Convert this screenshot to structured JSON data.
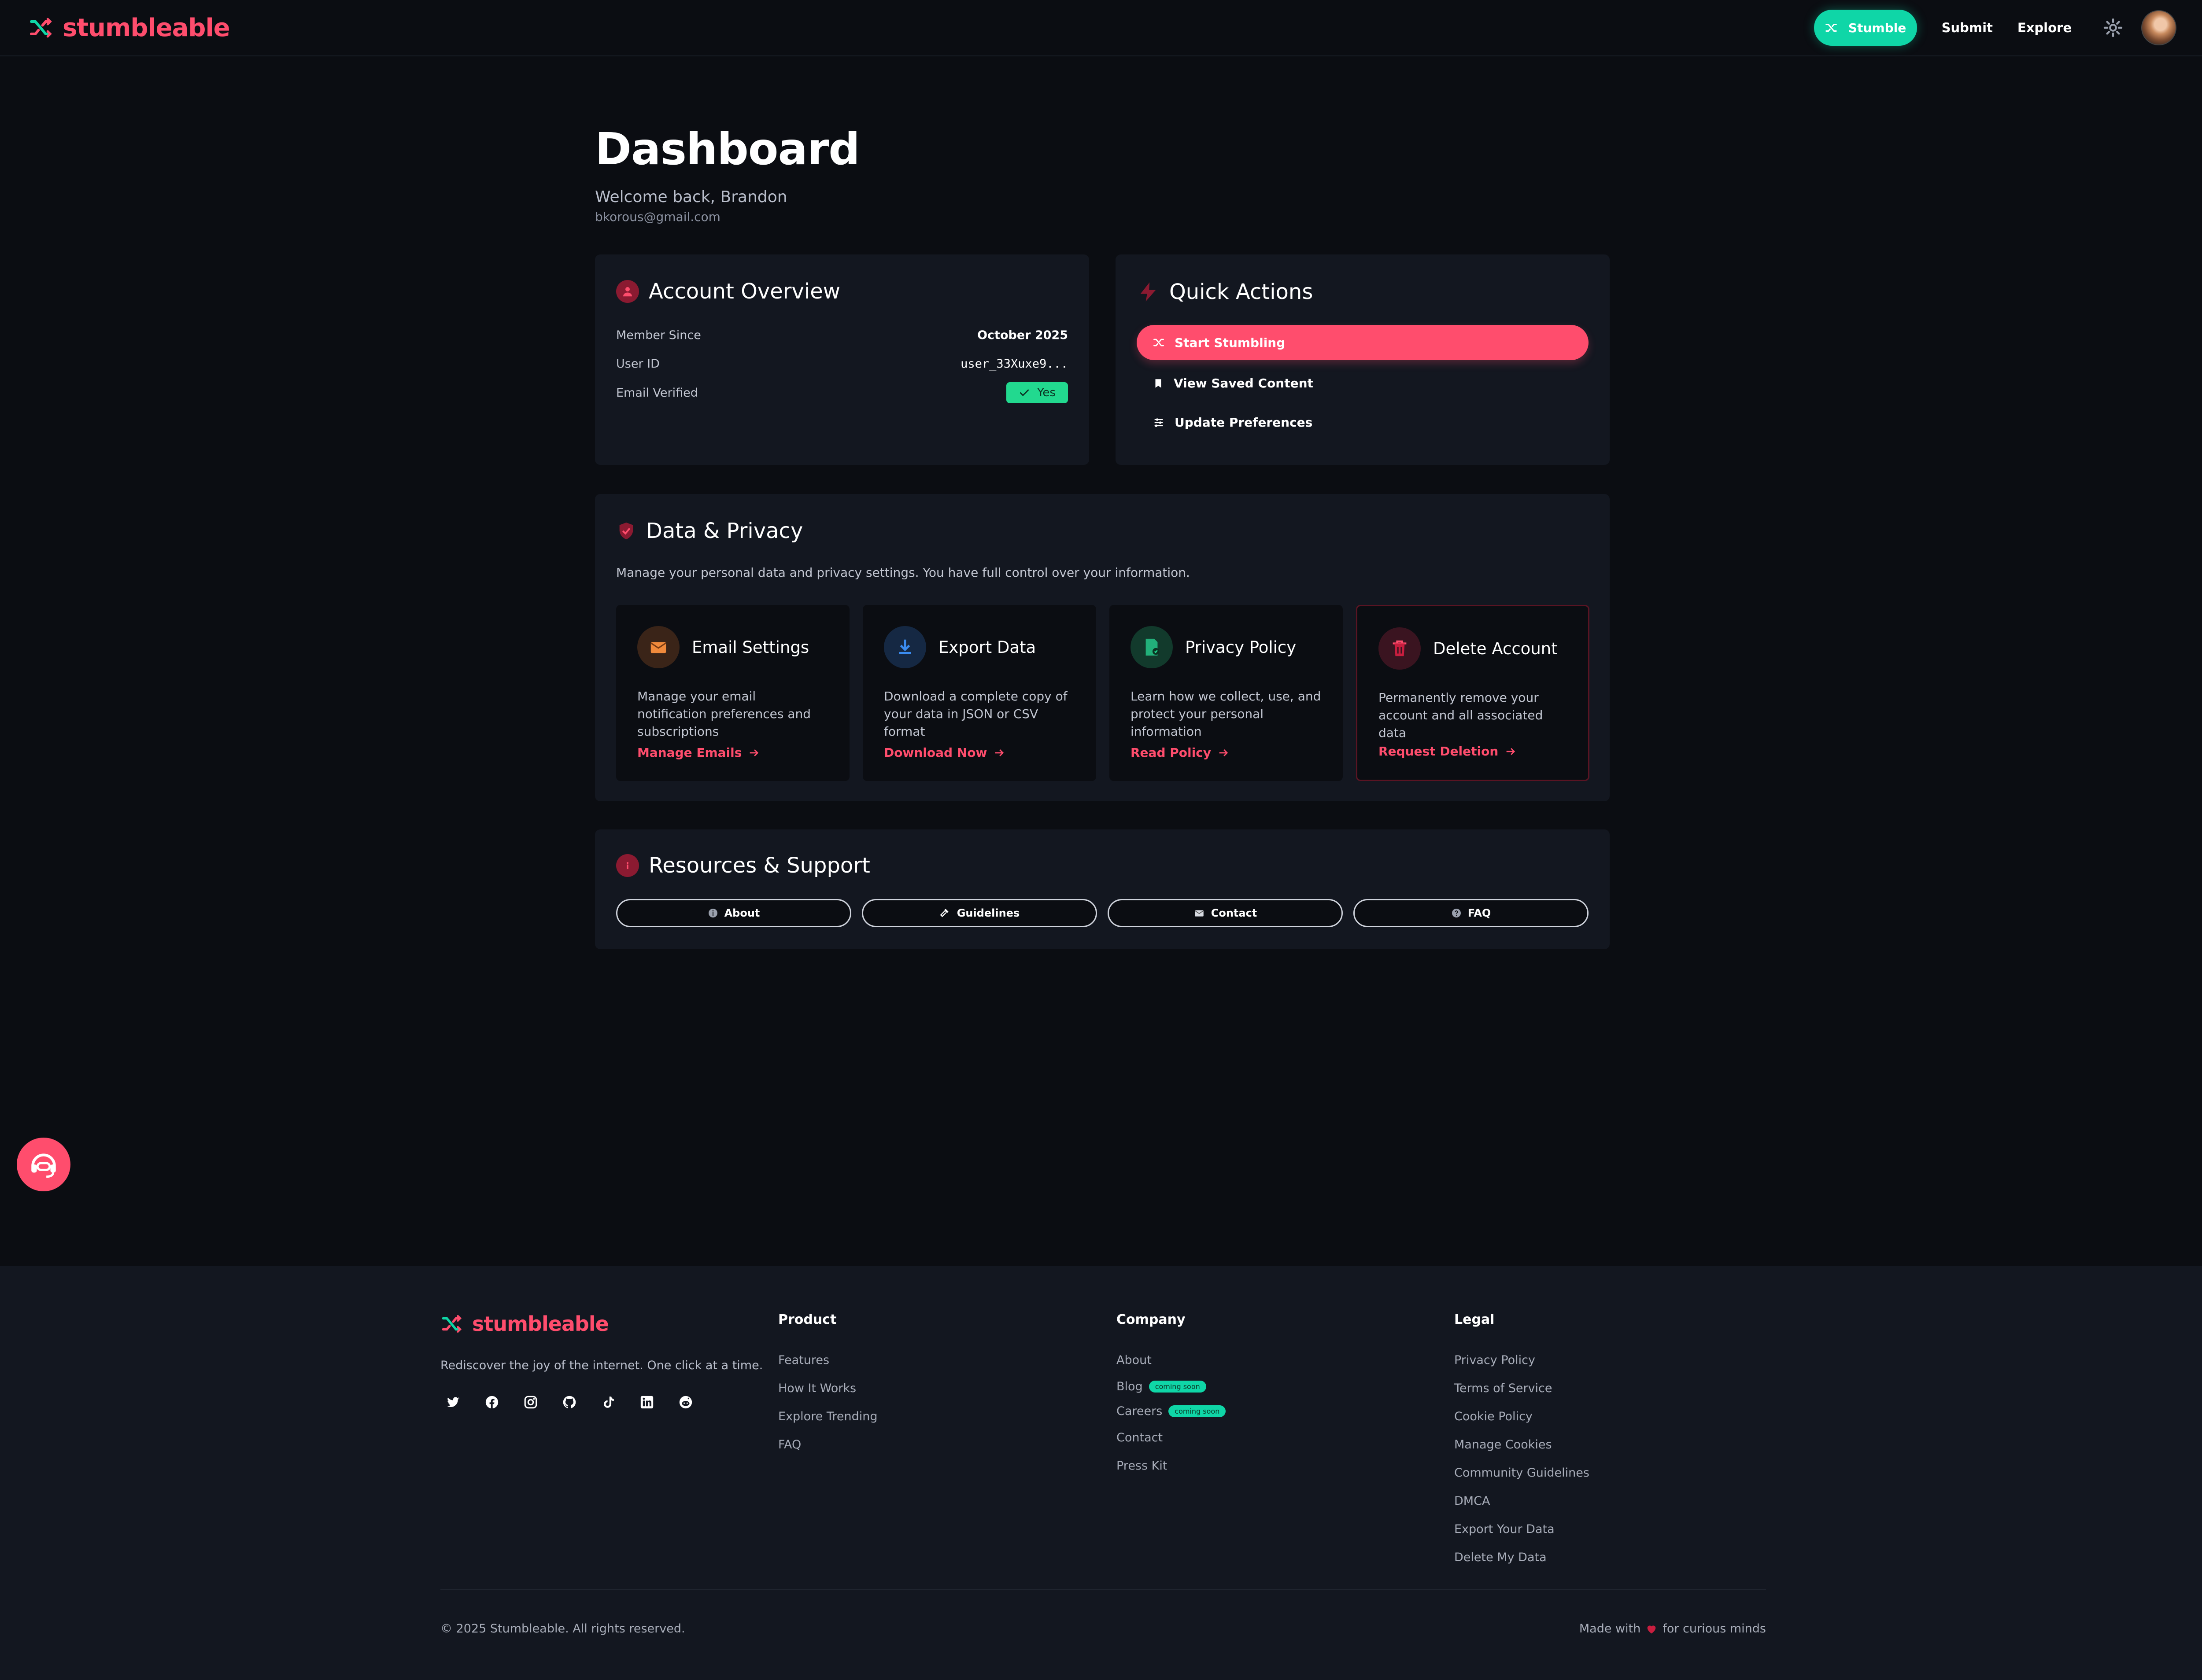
{
  "nav": {
    "brand": "stumbleable",
    "stumble_label": "Stumble",
    "submit_label": "Submit",
    "explore_label": "Explore"
  },
  "header": {
    "title": "Dashboard",
    "welcome": "Welcome back, Brandon",
    "email": "bkorous@gmail.com"
  },
  "account": {
    "title": "Account Overview",
    "member_since_label": "Member Since",
    "member_since_value": "October 2025",
    "user_id_label": "User ID",
    "user_id_value": "user_33Xuxe9...",
    "email_verified_label": "Email Verified",
    "email_verified_value": "Yes"
  },
  "quick_actions": {
    "title": "Quick Actions",
    "start": "Start Stumbling",
    "saved": "View Saved Content",
    "prefs": "Update Preferences"
  },
  "privacy": {
    "title": "Data & Privacy",
    "description": "Manage your personal data and privacy settings. You have full control over your information.",
    "cards": [
      {
        "title": "Email Settings",
        "text": "Manage your email notification preferences and subscriptions",
        "link": "Manage Emails"
      },
      {
        "title": "Export Data",
        "text": "Download a complete copy of your data in JSON or CSV format",
        "link": "Download Now"
      },
      {
        "title": "Privacy Policy",
        "text": "Learn how we collect, use, and protect your personal information",
        "link": "Read Policy"
      },
      {
        "title": "Delete Account",
        "text": "Permanently remove your account and all associated data",
        "link": "Request Deletion"
      }
    ]
  },
  "resources": {
    "title": "Resources & Support",
    "buttons": [
      "About",
      "Guidelines",
      "Contact",
      "FAQ"
    ]
  },
  "footer": {
    "brand": "stumbleable",
    "tagline": "Rediscover the joy of the internet. One click at a time.",
    "product": {
      "title": "Product",
      "links": [
        "Features",
        "How It Works",
        "Explore Trending",
        "FAQ"
      ]
    },
    "company": {
      "title": "Company",
      "links": [
        "About",
        "Blog",
        "Careers",
        "Contact",
        "Press Kit"
      ],
      "coming_soon": "coming soon"
    },
    "legal": {
      "title": "Legal",
      "links": [
        "Privacy Policy",
        "Terms of Service",
        "Cookie Policy",
        "Manage Cookies",
        "Community Guidelines",
        "DMCA",
        "Export Your Data",
        "Delete My Data"
      ]
    },
    "copyright": "© 2025 Stumbleable. All rights reserved.",
    "made_with_pre": "Made with",
    "made_with_post": "for curious minds"
  },
  "colors": {
    "accent": "#ff4d6d",
    "teal": "#0fd6a7",
    "background": "#0b0d12",
    "card": "#131720"
  }
}
